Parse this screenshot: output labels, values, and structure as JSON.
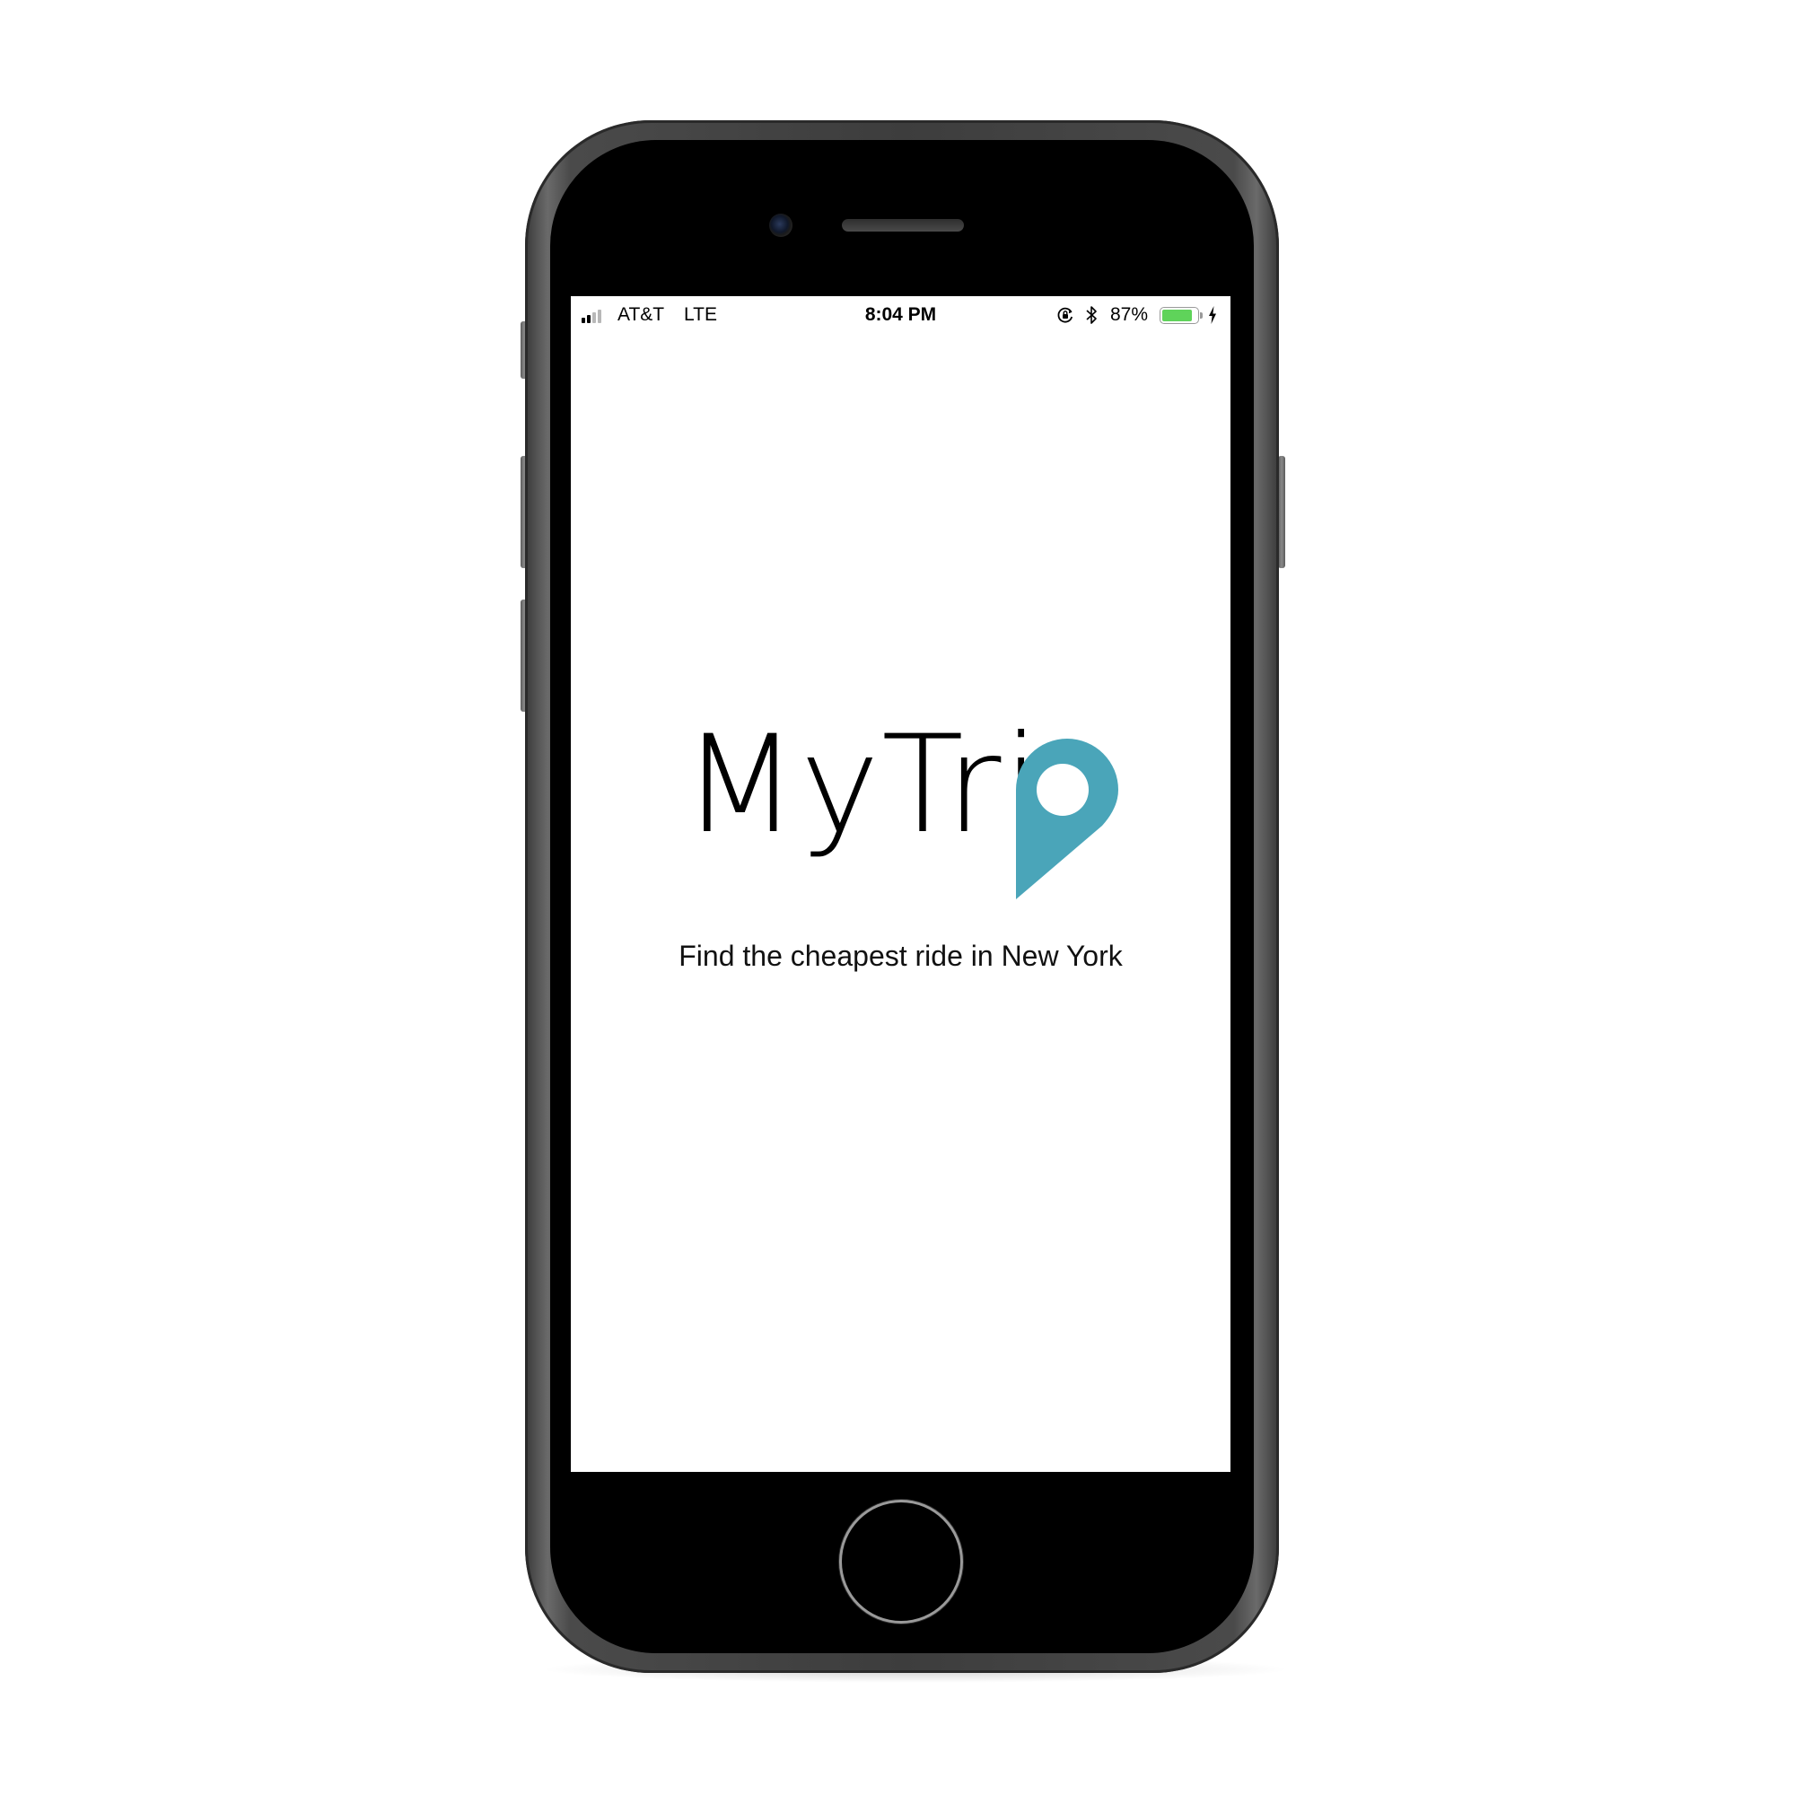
{
  "status_bar": {
    "carrier": "AT&T",
    "network": "LTE",
    "time": "8:04 PM",
    "battery_percent": "87%",
    "battery_level": 0.87,
    "signal_bars_filled": 2,
    "signal_bars_total": 4
  },
  "splash": {
    "logo_text": "MyTri",
    "logo_icon": "location-pin-icon",
    "tagline": "Find the cheapest ride in New York"
  },
  "colors": {
    "brand_accent": "#4aa5b9",
    "battery_fill": "#5fd35a",
    "screen_background": "#ffffff",
    "phone_body": "#3d3d3d"
  }
}
